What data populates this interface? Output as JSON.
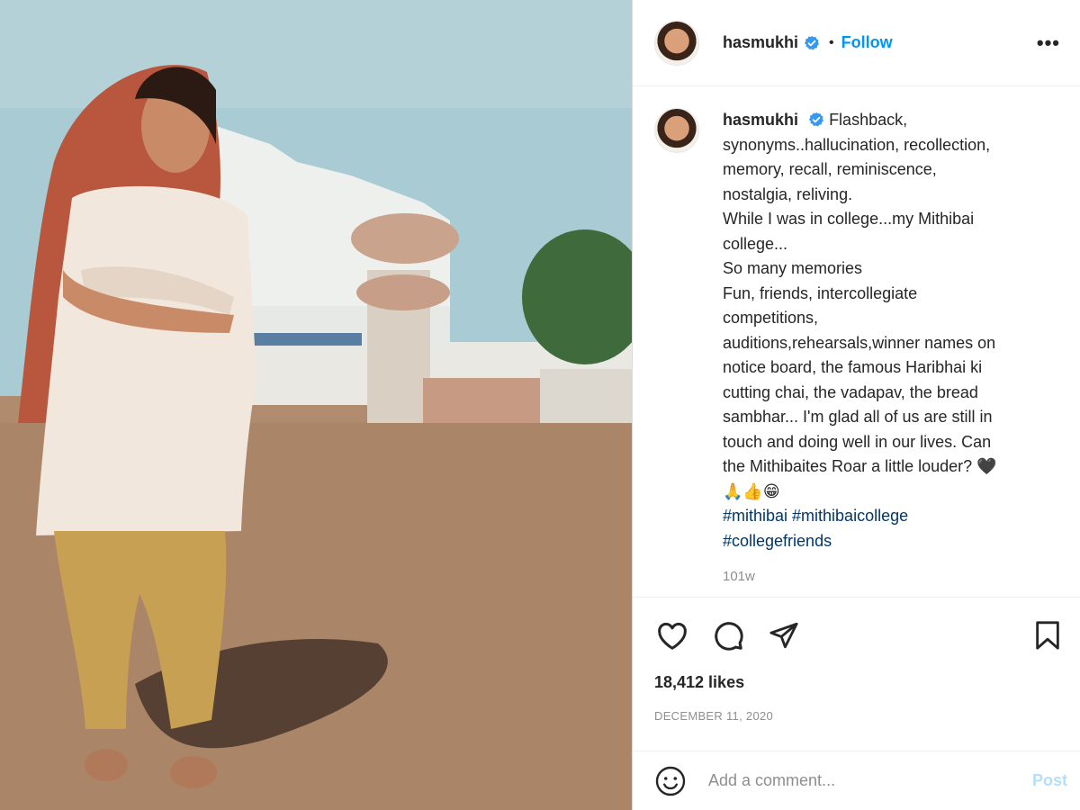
{
  "photo": {
    "alt_icon": "photo"
  },
  "header": {
    "username": "hasmukhi",
    "separator": "•",
    "follow_label": "Follow",
    "more_label": "•••"
  },
  "caption": {
    "username": "hasmukhi",
    "lines": [
      "Flashback,",
      "synonyms..hallucination, recollection,",
      "memory, recall, reminiscence,",
      "nostalgia, reliving.",
      "While I was in college...my Mithibai",
      "college...",
      "So many memories",
      "Fun, friends, intercollegiate",
      "competitions,",
      "auditions,rehearsals,winner names on",
      "notice board, the famous Haribhai ki",
      "cutting chai, the vadapav, the bread",
      "sambhar... I'm glad all of us are still in",
      "touch and doing well in our lives. Can",
      "the Mithibaites Roar a little louder? 🖤",
      "🙏👍😁"
    ],
    "hashtags": [
      "#mithibai #mithibaicollege",
      "#collegefriends"
    ],
    "time_ago": "101w"
  },
  "engagement": {
    "likes": "18,412 likes",
    "date": "DECEMBER 11, 2020"
  },
  "comment_box": {
    "placeholder": "Add a comment...",
    "post_label": "Post"
  },
  "colors": {
    "accent": "#0095f6",
    "hashtag": "#00376b",
    "muted": "#8e8e8e",
    "post_disabled": "#b2dffc"
  }
}
